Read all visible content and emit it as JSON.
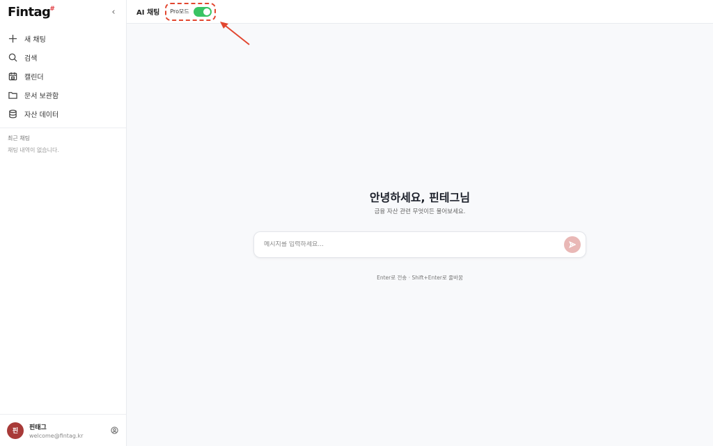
{
  "brand": {
    "name": "Fintag",
    "mark": "#"
  },
  "sidebar": {
    "collapse_glyph": "‹",
    "nav": [
      {
        "label": "새 채팅",
        "icon": "plus-icon"
      },
      {
        "label": "검색",
        "icon": "search-icon"
      },
      {
        "label": "캘린더",
        "icon": "calendar-icon"
      },
      {
        "label": "문서 보관함",
        "icon": "folder-icon"
      },
      {
        "label": "자산 데이터",
        "icon": "database-icon"
      }
    ],
    "recent_heading": "최근 채팅",
    "recent_empty": "채팅 내역이 없습니다."
  },
  "profile": {
    "initial": "핀",
    "name": "핀태그",
    "email": "welcome@fintag.kr"
  },
  "topbar": {
    "title": "AI 채팅",
    "pro_label": "Pro모드",
    "pro_enabled": true
  },
  "main": {
    "greeting": "안녕하세요, 핀테그님",
    "subtitle": "금융 자산 관련 무엇이든 물어보세요.",
    "input_placeholder": "메시지를 입력하세요...",
    "hint": "Enter로 전송 · Shift+Enter로 줄바꿈"
  },
  "colors": {
    "accent": "#a83a38",
    "toggle_on": "#39c463",
    "annotation": "#e2462f",
    "send_button": "#e9b8b6"
  }
}
